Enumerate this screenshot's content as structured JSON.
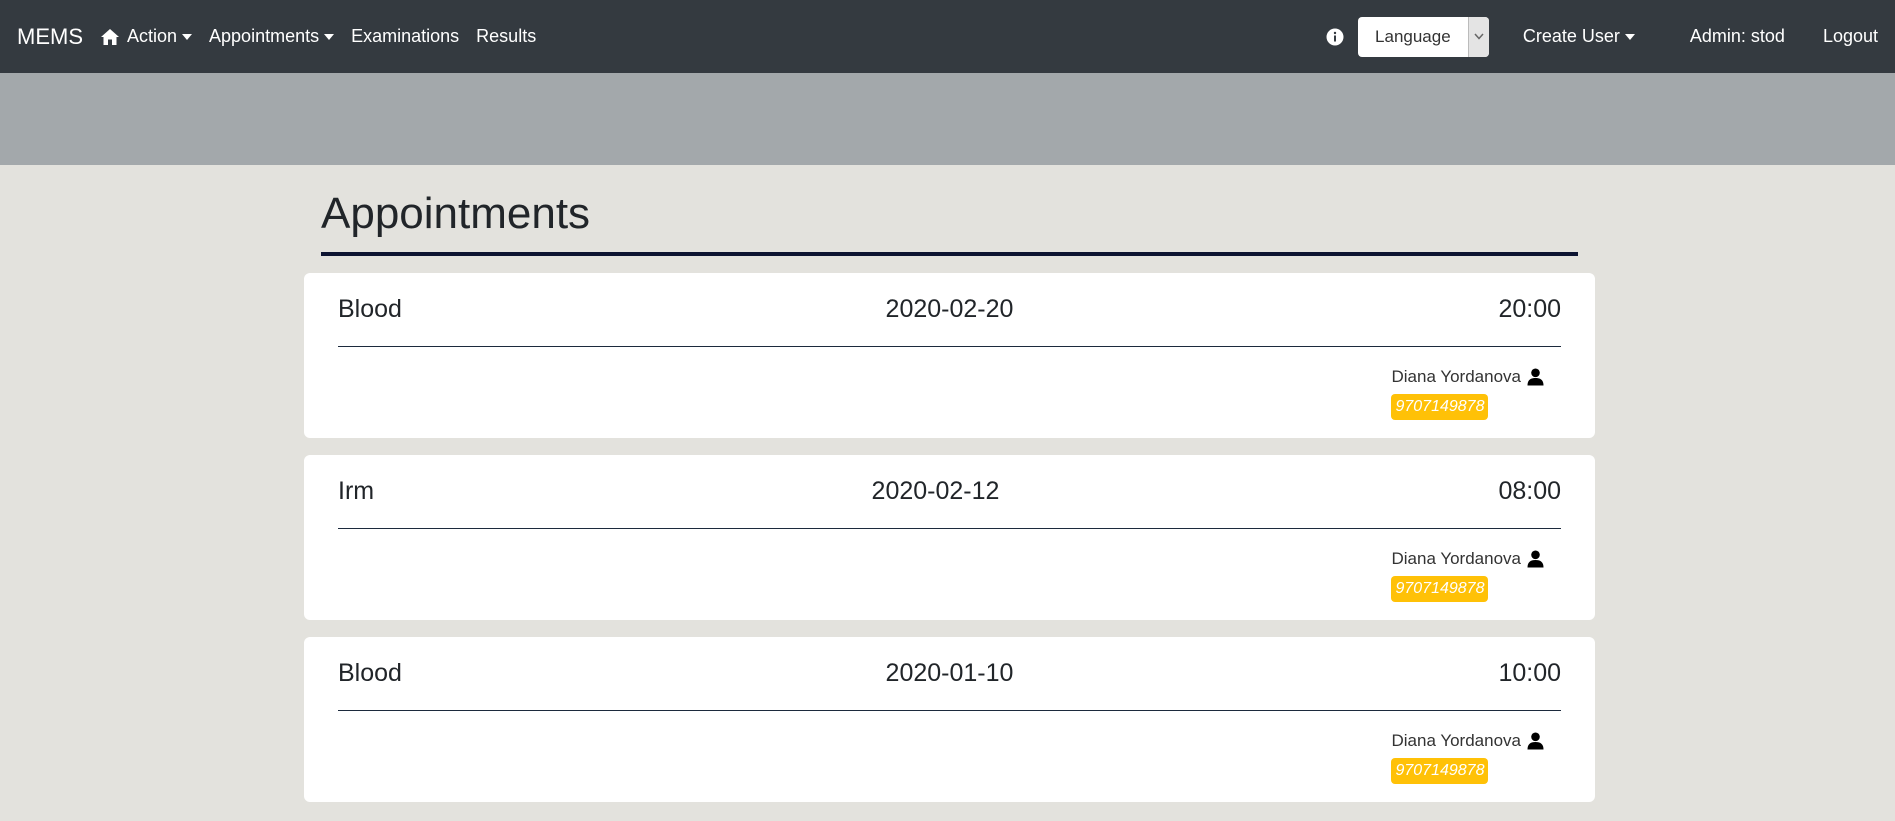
{
  "navbar": {
    "brand": "MEMS",
    "action_label": "Action",
    "appointments_label": "Appointments",
    "examinations_label": "Examinations",
    "results_label": "Results",
    "language_label": "Language",
    "create_user_label": "Create User",
    "admin_label": "Admin: stod",
    "logout_label": "Logout"
  },
  "page": {
    "title": "Appointments"
  },
  "appointments": [
    {
      "type": "Blood",
      "date": "2020-02-20",
      "time": "20:00",
      "patient": "Diana Yordanova",
      "id": "9707149878"
    },
    {
      "type": "Irm",
      "date": "2020-02-12",
      "time": "08:00",
      "patient": "Diana Yordanova",
      "id": "9707149878"
    },
    {
      "type": "Blood",
      "date": "2020-01-10",
      "time": "10:00",
      "patient": "Diana Yordanova",
      "id": "9707149878"
    }
  ],
  "colors": {
    "navbar": "#343a40",
    "hero": "#a3a8ab",
    "background": "#e3e2dd",
    "badge": "#ffc107",
    "title_rule": "#0d1431"
  }
}
